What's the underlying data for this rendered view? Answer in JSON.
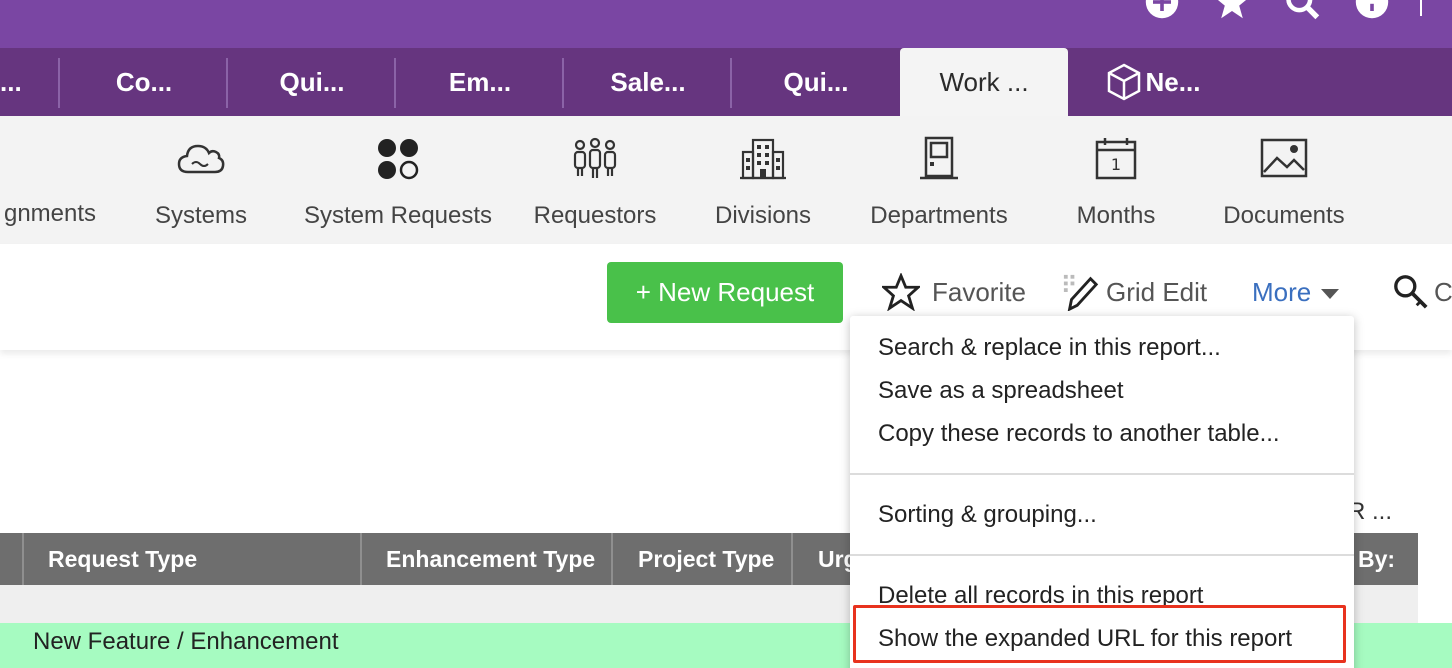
{
  "tabs": [
    {
      "label": "...",
      "active": false
    },
    {
      "label": "Co...",
      "active": false
    },
    {
      "label": "Qui...",
      "active": false
    },
    {
      "label": "Em...",
      "active": false
    },
    {
      "label": "Sale...",
      "active": false
    },
    {
      "label": "Qui...",
      "active": false
    },
    {
      "label": "Work ...",
      "active": true
    },
    {
      "label": "Ne...",
      "active": false
    }
  ],
  "modules": [
    {
      "label": "gnments",
      "icon": "assignments-icon"
    },
    {
      "label": "Systems",
      "icon": "cloud-icon"
    },
    {
      "label": "System Requests",
      "icon": "four-circles-icon"
    },
    {
      "label": "Requestors",
      "icon": "people-group-icon"
    },
    {
      "label": "Divisions",
      "icon": "building-icon"
    },
    {
      "label": "Departments",
      "icon": "door-icon"
    },
    {
      "label": "Months",
      "icon": "calendar-icon",
      "calendar_day": "1"
    },
    {
      "label": "Documents",
      "icon": "image-icon"
    }
  ],
  "toolbar": {
    "new_request": "+ New Request",
    "favorite": "Favorite",
    "grid_edit": "Grid Edit",
    "more": "More",
    "cut_label": "C"
  },
  "table": {
    "right_label": "R ...",
    "headers": [
      "Request Type",
      "Enhancement Type",
      "Project Type",
      "Urg",
      "By:"
    ],
    "row1_request_type": "New Feature / Enhancement"
  },
  "menu": {
    "items": [
      "Search & replace in this report...",
      "Save as a spreadsheet",
      "Copy these records to another table...",
      "Sorting & grouping...",
      "Delete all records in this report",
      "Show the expanded URL for this report"
    ]
  },
  "colors": {
    "topbar": "#7a46a3",
    "tabbar": "#66357f",
    "new_button": "#49c14a",
    "more_link": "#3a6fbf",
    "highlight_row": "#a6fbc1",
    "annotation": "#e8321e"
  }
}
